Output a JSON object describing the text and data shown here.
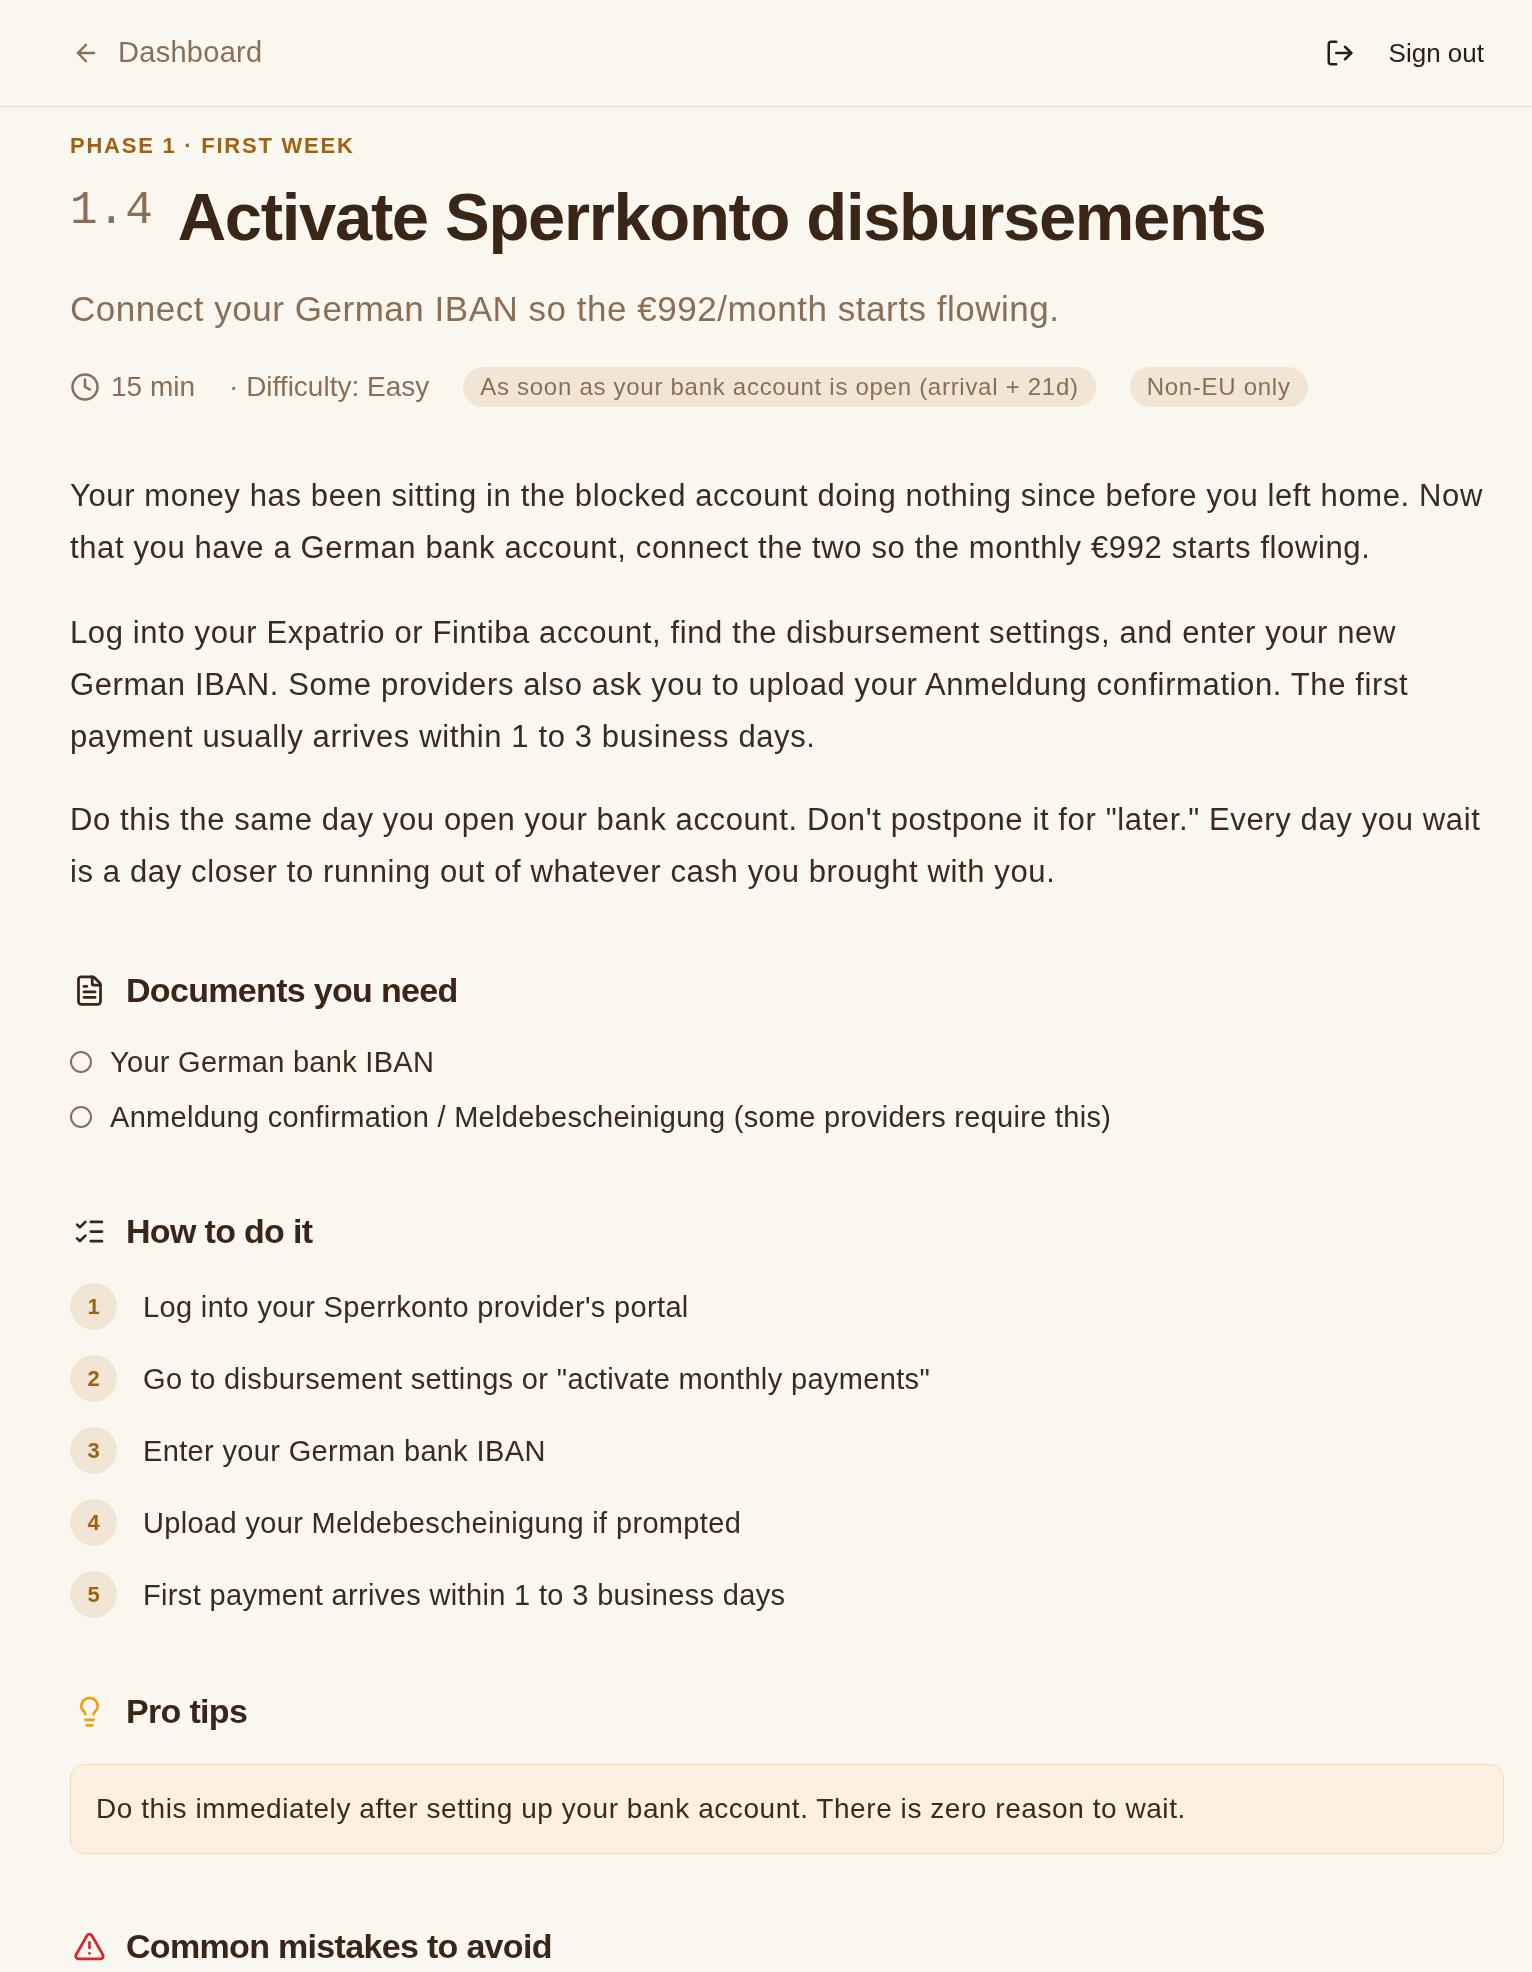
{
  "nav": {
    "back_link": "Dashboard",
    "sign_out": "Sign out"
  },
  "lesson": {
    "phase": "PHASE 1 · FIRST WEEK",
    "number": "1.4",
    "title": "Activate Sperrkonto disbursements",
    "subtitle": "Connect your German IBAN so the €992/month starts flowing."
  },
  "meta": {
    "duration": "15 min",
    "difficulty": "· Difficulty: Easy",
    "tags": [
      "As soon as your bank account is open (arrival + 21d)",
      "Non-EU only"
    ]
  },
  "paragraphs": [
    "Your money has been sitting in the blocked account doing nothing since before you left home. Now that you have a German bank account, connect the two so the monthly €992 starts flowing.",
    "Log into your Expatrio or Fintiba account, find the disbursement settings, and enter your new German IBAN. Some providers also ask you to upload your Anmeldung confirmation. The first payment usually arrives within 1 to 3 business days.",
    "Do this the same day you open your bank account. Don't postpone it for \"later.\" Every day you wait is a day closer to running out of whatever cash you brought with you."
  ],
  "sections": [
    {
      "kind": "documents",
      "title": "Documents you need",
      "items": [
        {
          "text": "Your German bank IBAN",
          "checked": false
        },
        {
          "text": "Anmeldung confirmation / Meldebescheinigung (some providers require this)",
          "checked": false
        }
      ]
    },
    {
      "kind": "steps",
      "title": "How to do it",
      "steps": [
        {
          "number": "1",
          "text": "Log into your Sperrkonto provider's portal"
        },
        {
          "number": "2",
          "text": "Go to disbursement settings or \"activate monthly payments\""
        },
        {
          "number": "3",
          "text": "Enter your German bank IBAN"
        },
        {
          "number": "4",
          "text": "Upload your Meldebescheinigung if prompted"
        },
        {
          "number": "5",
          "text": "First payment arrives within 1 to 3 business days"
        }
      ]
    },
    {
      "kind": "tips",
      "title": "Pro tips",
      "tips": [
        "Do this immediately after setting up your bank account. There is zero reason to wait."
      ]
    },
    {
      "kind": "mistakes",
      "title": "Common mistakes to avoid"
    }
  ]
}
